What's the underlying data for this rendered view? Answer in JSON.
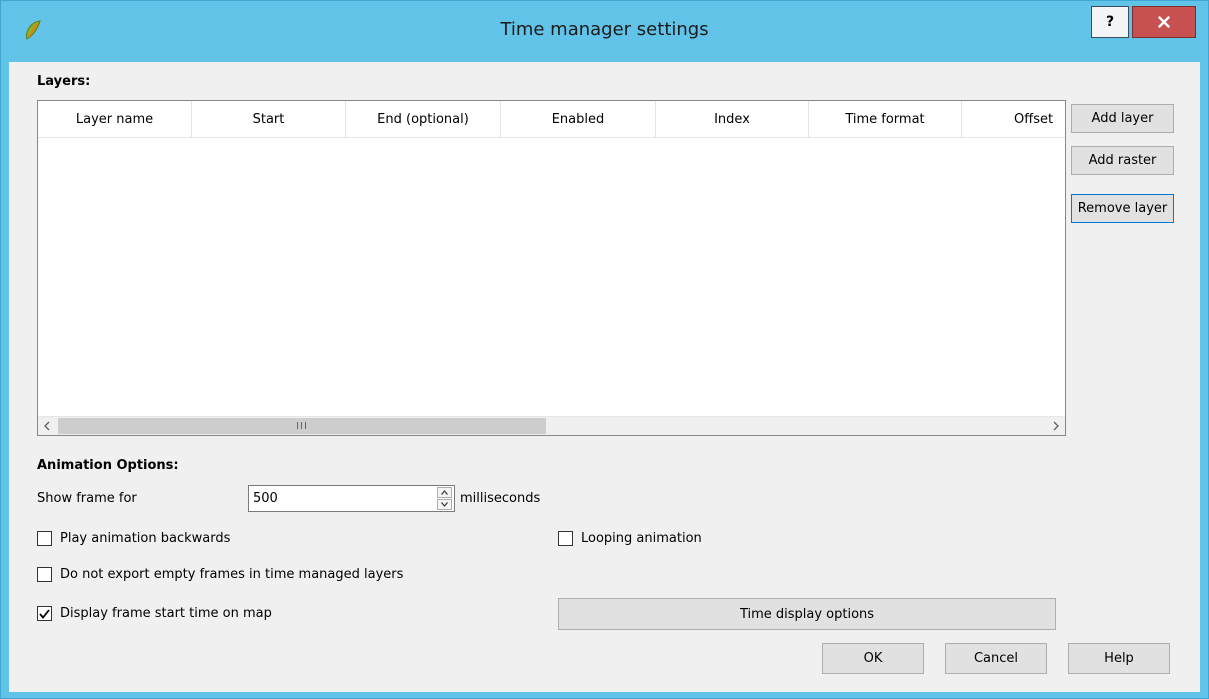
{
  "window": {
    "title": "Time manager settings",
    "help_label": "?",
    "app_icon": "qgis-icon",
    "colors": {
      "titlebar": "#62c3e8",
      "close": "#c75050",
      "client": "#f0f0f0"
    }
  },
  "layers": {
    "section_label": "Layers:",
    "columns": [
      "Layer name",
      "Start",
      "End (optional)",
      "Enabled",
      "Index",
      "Time format",
      "Offset"
    ],
    "rows": [],
    "buttons": {
      "add_layer": "Add layer",
      "add_raster": "Add raster",
      "remove_layer": "Remove layer"
    },
    "scrollbar_thumb_glyph": "III"
  },
  "animation": {
    "section_label": "Animation Options:",
    "show_frame_label": "Show frame for",
    "frame_value": "500",
    "unit_label": "milliseconds",
    "play_backwards": {
      "label": "Play animation backwards",
      "checked": false
    },
    "looping": {
      "label": "Looping animation",
      "checked": false
    },
    "no_empty_frames": {
      "label": "Do not export empty frames in time managed layers",
      "checked": false
    },
    "display_start_time": {
      "label": "Display frame start time on map",
      "checked": true
    },
    "time_display_options_label": "Time display options"
  },
  "footer": {
    "ok_label": "OK",
    "cancel_label": "Cancel",
    "help_label": "Help"
  }
}
